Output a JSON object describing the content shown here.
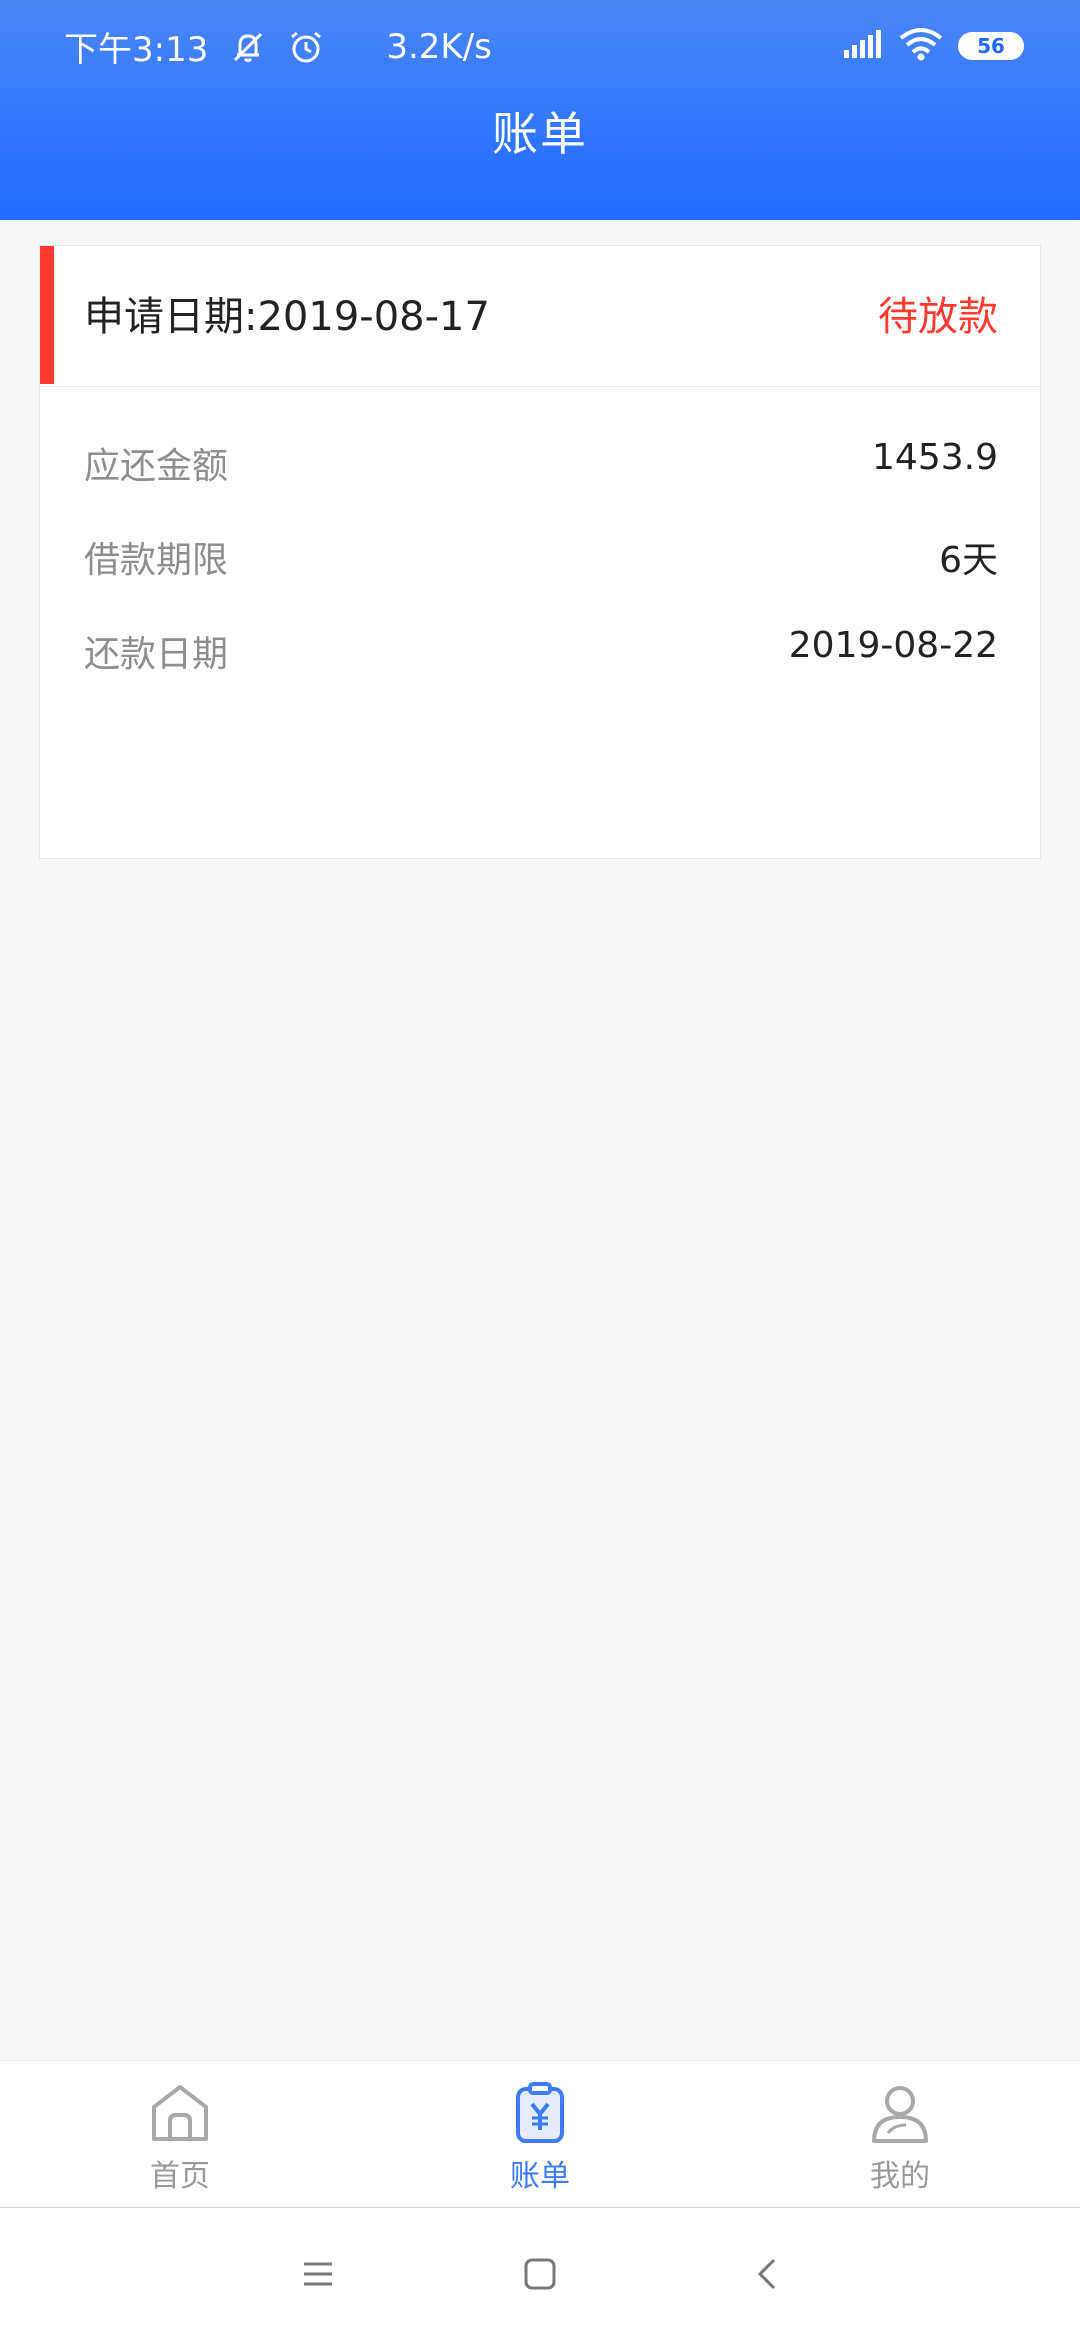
{
  "status_bar": {
    "time": "下午3:13",
    "speed": "3.2K/s",
    "battery": "56",
    "icons": [
      "mute-bell-icon",
      "alarm-icon",
      "signal-icon",
      "wifi-icon",
      "battery-icon"
    ]
  },
  "header": {
    "title": "账单"
  },
  "bill": {
    "apply_date_label": "申请日期:2019-08-17",
    "status": "待放款",
    "rows": [
      {
        "label": "应还金额",
        "value": "1453.9"
      },
      {
        "label": "借款期限",
        "value": "6天"
      },
      {
        "label": "还款日期",
        "value": "2019-08-22"
      }
    ]
  },
  "tabs": [
    {
      "label": "首页",
      "icon": "home-icon",
      "active": false
    },
    {
      "label": "账单",
      "icon": "bill-icon",
      "active": true
    },
    {
      "label": "我的",
      "icon": "user-icon",
      "active": false
    }
  ],
  "system_nav": [
    "menu-icon",
    "home-square-icon",
    "back-icon"
  ],
  "colors": {
    "header_blue": "#1f6bff",
    "accent_red": "#ff3b30",
    "active_tab": "#3d7cf5",
    "inactive_tab": "#9a9a9a"
  }
}
